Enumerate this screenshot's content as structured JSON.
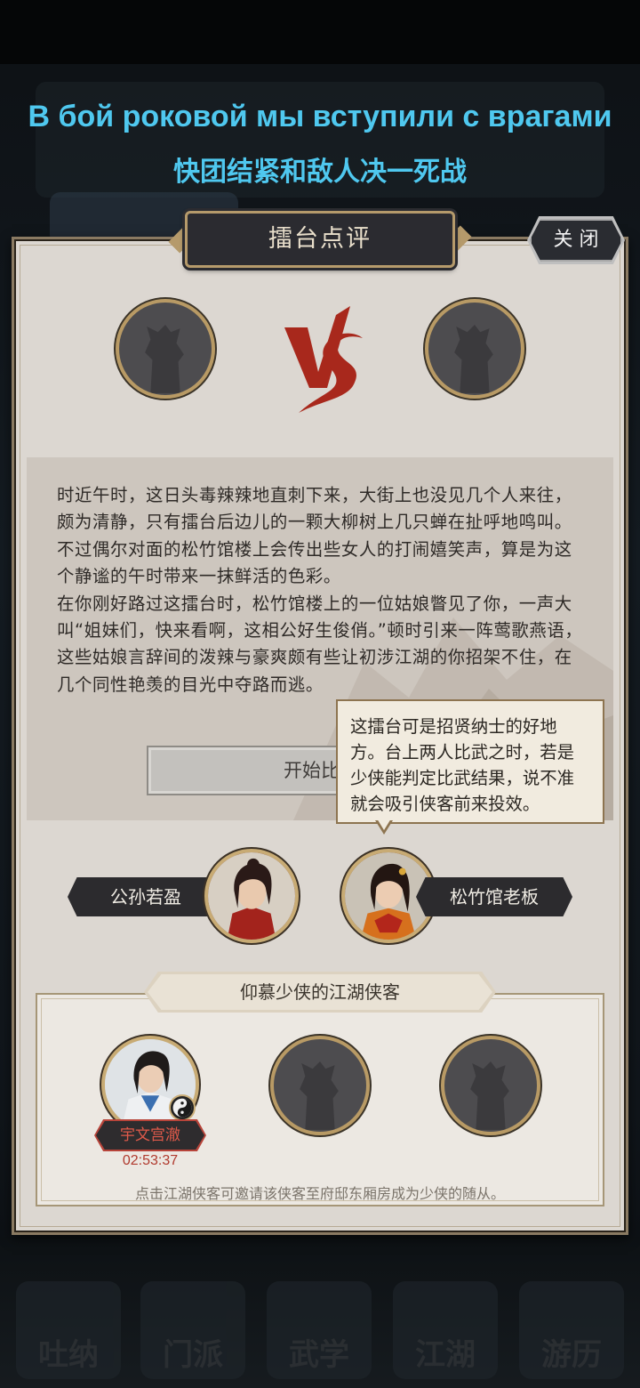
{
  "promo": {
    "line1": "В бой роковой мы вступили с врагами",
    "line2": "快团结紧和敌人决一死战"
  },
  "dialog": {
    "title": "擂台点评",
    "close_label": "关 闭",
    "story": [
      "时近午时，这日头毒辣辣地直刺下来，大街上也没见几个人来往，颇为清静，只有擂台后边儿的一颗大柳树上几只蝉在扯呼地鸣叫。不过偶尔对面的松竹馆楼上会传出些女人的打闹嬉笑声，算是为这个静谧的午时带来一抹鲜活的色彩。",
      "在你刚好路过这擂台时，松竹馆楼上的一位姑娘瞥见了你，一声大叫“姐妹们，快来看啊，这相公好生俊俏。”顿时引来一阵莺歌燕语，这些姑娘言辞间的泼辣与豪爽颇有些让初涉江湖的你招架不住，在几个同性艳羡的目光中夺路而逃。"
    ],
    "start_button": "开始比",
    "tooltip": "这擂台可是招贤纳士的好地方。台上两人比武之时，若是少侠能判定比武结果，说不准就会吸引侠客前来投效。",
    "fighter_left": "公孙若盈",
    "fighter_right": "松竹馆老板",
    "admirers_title": "仰慕少侠的江湖侠客",
    "admirer_name": "宇文宫澈",
    "admirer_timer": "02:53:37",
    "hint": "点击江湖侠客可邀请该侠客至府邸东厢房成为少侠的随从。"
  },
  "bottom_nav": [
    "吐纳",
    "门派",
    "武学",
    "江湖",
    "游历"
  ],
  "colors": {
    "promo": "#4fc8ef",
    "gold": "#b89a65",
    "panel": "#dcd7d1"
  }
}
